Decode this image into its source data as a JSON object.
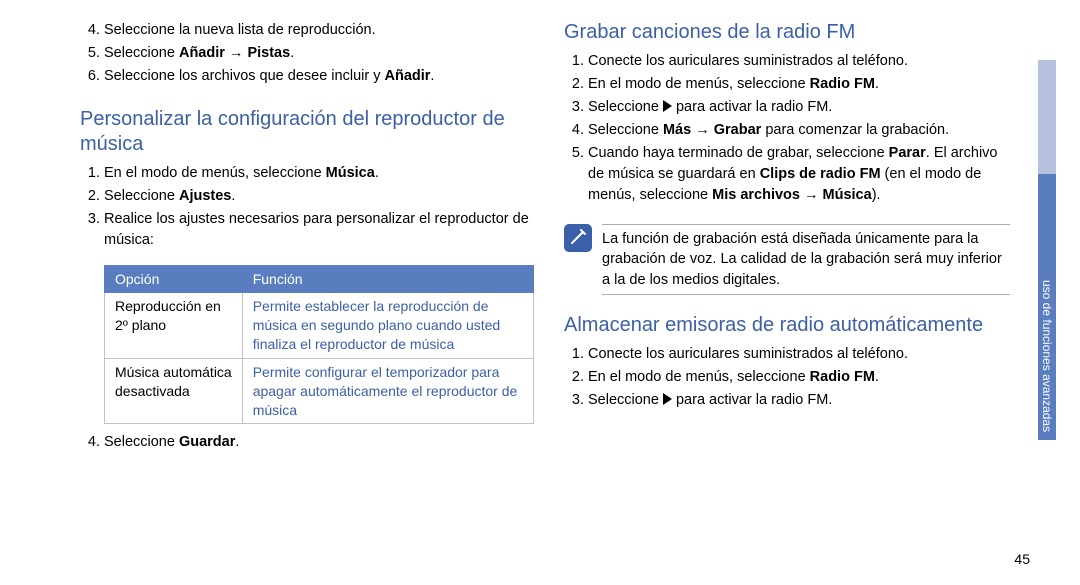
{
  "leftCol": {
    "list1": [
      {
        "n": "4.",
        "text": "Seleccione la nueva lista de reproducción."
      },
      {
        "n": "5.",
        "prefix": "Seleccione ",
        "bold1": "Añadir",
        "mid": " → ",
        "bold2": "Pistas",
        "suffix": "."
      },
      {
        "n": "6.",
        "prefix": "Seleccione los archivos que desee incluir y ",
        "bold1": "Añadir",
        "suffix": "."
      }
    ],
    "heading": "Personalizar la configuración del reproductor de música",
    "list2": [
      {
        "n": "1.",
        "prefix": "En el modo de menús, seleccione ",
        "bold1": "Música",
        "suffix": "."
      },
      {
        "n": "2.",
        "prefix": "Seleccione ",
        "bold1": "Ajustes",
        "suffix": "."
      },
      {
        "n": "3.",
        "text": "Realice los ajustes necesarios para personalizar el reproductor de música:"
      }
    ],
    "table": {
      "h1": "Opción",
      "h2": "Función",
      "rows": [
        {
          "opt": "Reproducción en 2º plano",
          "desc": "Permite establecer la reproducción de música en segundo plano cuando usted finaliza el reproductor de música"
        },
        {
          "opt": "Música automática desactivada",
          "desc": "Permite configurar el temporizador para apagar automáticamente el reproductor de música"
        }
      ]
    },
    "list3": [
      {
        "n": "4.",
        "prefix": "Seleccione ",
        "bold1": "Guardar",
        "suffix": "."
      }
    ]
  },
  "rightCol": {
    "heading1": "Grabar canciones de la radio FM",
    "listA": [
      {
        "n": "1.",
        "text": "Conecte los auriculares suministrados al teléfono."
      },
      {
        "n": "2.",
        "prefix": "En el modo de menús, seleccione ",
        "bold1": "Radio FM",
        "suffix": "."
      },
      {
        "n": "3.",
        "text": "Seleccione ",
        "play": true,
        "suffix": " para activar la radio FM."
      },
      {
        "n": "4.",
        "prefix": "Seleccione ",
        "bold1": "Más",
        "mid": " → ",
        "bold2": "Grabar",
        "suffix": " para comenzar la grabación."
      },
      {
        "n": "5.",
        "prefix": "Cuando haya terminado de grabar, seleccione ",
        "bold1": "Parar",
        "suffix": ". El archivo de música se guardará en ",
        "bold2": "Clips de radio FM",
        "suffix2": " (en el modo de menús, seleccione ",
        "bold3": "Mis archivos",
        "mid3": " → ",
        "bold4": "Música",
        "suffix3": ")."
      }
    ],
    "note": "La función de grabación está diseñada únicamente para la grabación de voz. La calidad de la grabación será muy inferior a la de los medios digitales.",
    "heading2": "Almacenar emisoras de radio automáticamente",
    "listB": [
      {
        "n": "1.",
        "text": "Conecte los auriculares suministrados al teléfono."
      },
      {
        "n": "2.",
        "prefix": "En el modo de menús, seleccione ",
        "bold1": "Radio FM",
        "suffix": "."
      },
      {
        "n": "3.",
        "text": "Seleccione ",
        "play": true,
        "suffix": " para activar la radio FM."
      }
    ]
  },
  "sidetab": "uso de funciones avanzadas",
  "pagenum": "45"
}
